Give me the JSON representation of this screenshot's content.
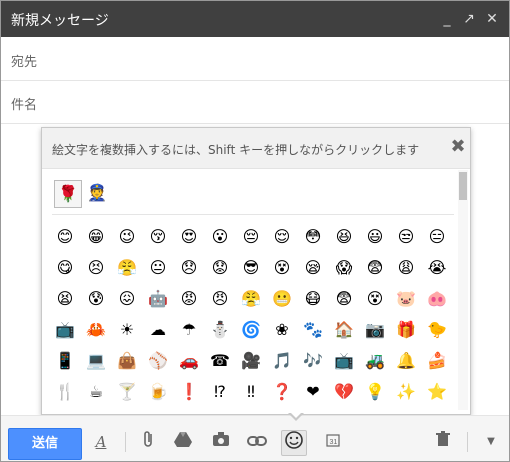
{
  "window": {
    "title": "新規メッセージ",
    "minimize_glyph": "_",
    "popout_glyph": "↗",
    "close_glyph": "✕"
  },
  "fields": {
    "to_label": "宛先",
    "subject_label": "件名"
  },
  "emoji_panel": {
    "hint": "絵文字を複数挿入するには、Shift キーを押しながらクリックします",
    "close_glyph": "✖",
    "tabs": [
      {
        "icon": "flower-icon",
        "glyph": "🌹"
      },
      {
        "icon": "face-icon",
        "glyph": "👮"
      }
    ],
    "rows": [
      [
        "😊",
        "😁",
        "😉",
        "😚",
        "😍",
        "😮",
        "😔",
        "😌",
        "😳",
        "😆",
        "😃",
        "😒",
        "😑"
      ],
      [
        "😋",
        "😣",
        "😤",
        "😐",
        "😞",
        "😟",
        "😎",
        "😵",
        "😪",
        "😱",
        "😨",
        "😩",
        "😭"
      ],
      [
        "😫",
        "😰",
        "😖",
        "🤖",
        "😡",
        "😠",
        "😤",
        "😬",
        "😷",
        "😨",
        "😵",
        "🐷",
        "🐽"
      ],
      [
        "📺",
        "🦀",
        "☀",
        "☁",
        "☂",
        "⛄",
        "🌀",
        "❀",
        "🐾",
        "🏠",
        "📷",
        "🎁",
        "🐤"
      ],
      [
        "📱",
        "💻",
        "👜",
        "⚾",
        "🚗",
        "☎",
        "🎥",
        "🎵",
        "🎶",
        "📺",
        "🚜",
        "🔔",
        "🍰"
      ],
      [
        "🍴",
        "☕",
        "🍸",
        "🍺",
        "❗",
        "⁉",
        "‼",
        "❓",
        "❤",
        "💔",
        "💡",
        "✨",
        "⭐"
      ],
      [
        "🛎",
        "",
        "",
        "",
        "",
        "",
        "",
        "",
        "",
        "",
        "",
        "",
        ""
      ]
    ],
    "colors": {
      "row1": "#e0b000",
      "row2": "#22a34a",
      "row3": "#1e90d6"
    }
  },
  "toolbar": {
    "send_label": "送信",
    "format_icon": "text-format-icon",
    "attach_icon": "paperclip-icon",
    "drive_icon": "drive-icon",
    "photo_icon": "camera-icon",
    "link_icon": "link-icon",
    "emoji_icon": "smiley-icon",
    "invite_icon": "calendar-icon",
    "discard_icon": "trash-icon",
    "more_icon": "chevron-down-icon"
  }
}
